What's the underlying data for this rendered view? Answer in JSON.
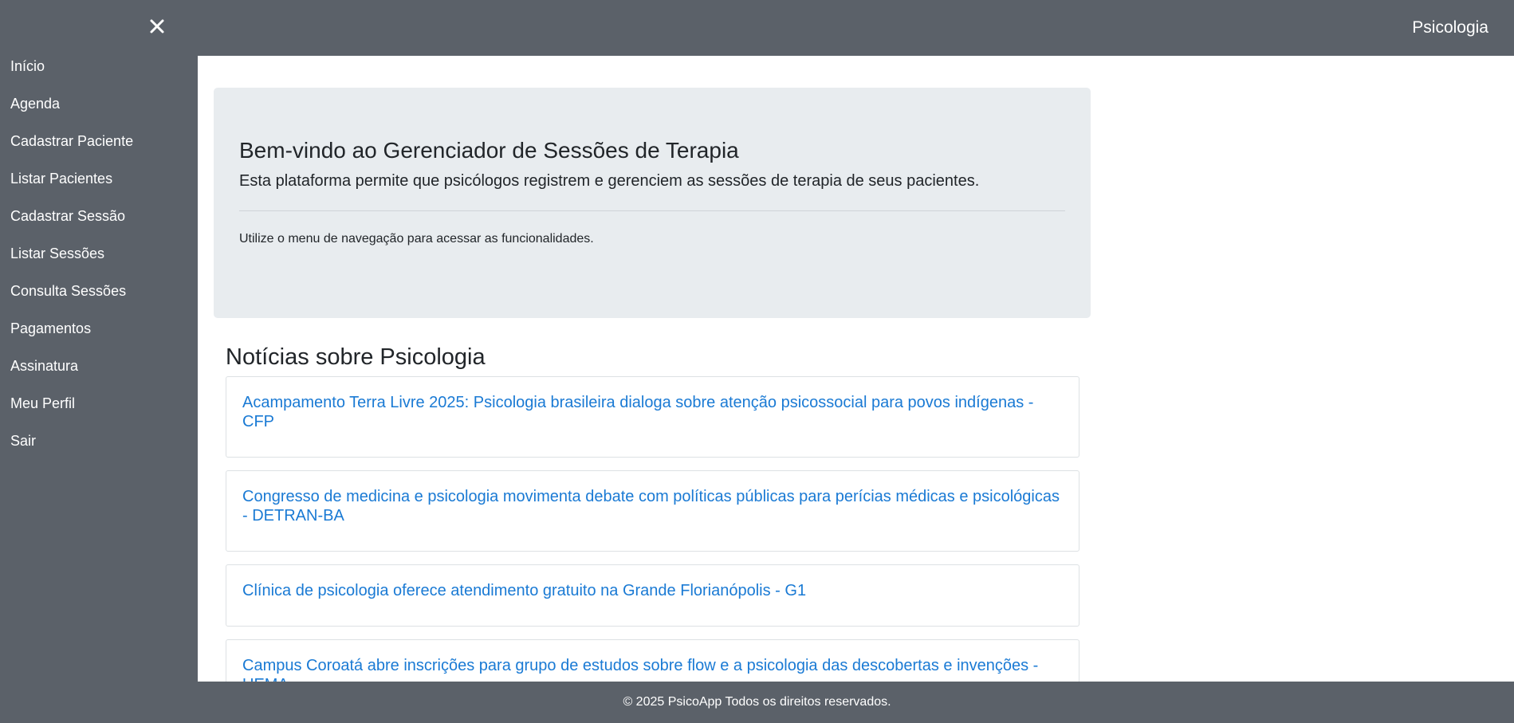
{
  "header": {
    "brand": "Psicologia"
  },
  "sidebar": {
    "close_icon": "close-icon",
    "items": [
      {
        "label": "Início"
      },
      {
        "label": "Agenda"
      },
      {
        "label": "Cadastrar Paciente"
      },
      {
        "label": "Listar Pacientes"
      },
      {
        "label": "Cadastrar Sessão"
      },
      {
        "label": "Listar Sessões"
      },
      {
        "label": "Consulta Sessões"
      },
      {
        "label": "Pagamentos"
      },
      {
        "label": "Assinatura"
      },
      {
        "label": "Meu Perfil"
      },
      {
        "label": "Sair"
      }
    ]
  },
  "welcome": {
    "title": "Bem-vindo ao Gerenciador de Sessões de Terapia",
    "lead": "Esta plataforma permite que psicólogos registrem e gerenciem as sessões de terapia de seus pacientes.",
    "text": "Utilize o menu de navegação para acessar as funcionalidades."
  },
  "news": {
    "title": "Notícias sobre Psicologia",
    "items": [
      {
        "headline": "Acampamento Terra Livre 2025: Psicologia brasileira dialoga sobre atenção psicossocial para povos indígenas - CFP"
      },
      {
        "headline": "Congresso de medicina e psicologia movimenta debate com políticas públicas para perícias médicas e psicológicas - DETRAN-BA"
      },
      {
        "headline": "Clínica de psicologia oferece atendimento gratuito na Grande Florianópolis - G1"
      },
      {
        "headline": "Campus Coroatá abre inscrições para grupo de estudos sobre flow e a psicologia das descobertas e invenções - UEMA"
      }
    ]
  },
  "footer": {
    "text": "© 2025 PsicoApp Todos os direitos reservados."
  },
  "colors": {
    "chrome": "#5b6169",
    "jumbotron_bg": "#e8ecef",
    "link": "#1a7ad4"
  }
}
